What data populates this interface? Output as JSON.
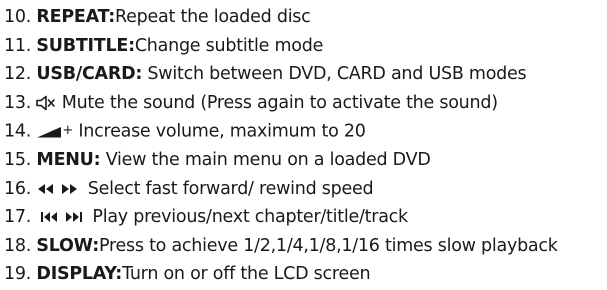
{
  "items": [
    {
      "num": "10.",
      "key": "REPEAT:",
      "text": "Repeat the loaded disc"
    },
    {
      "num": "11.",
      "key": "SUBTITLE:",
      "text": "Change subtitle mode"
    },
    {
      "num": "12.",
      "key": "USB/CARD:",
      "text": " Switch between DVD, CARD and USB modes"
    },
    {
      "num": "13.",
      "icon": "mute-icon",
      "text": " Mute the sound (Press again to activate the sound)"
    },
    {
      "num": "14.",
      "icon": "volume-up-icon",
      "plus": "+",
      "text": " Increase volume, maximum to 20"
    },
    {
      "num": "15.",
      "key": "MENU:",
      "text": " View the main menu on a loaded DVD"
    },
    {
      "num": "16.",
      "icon": "rewind-fast-forward-icon",
      "text": " Select fast forward/ rewind speed"
    },
    {
      "num": "17.",
      "icon": "previous-next-icon",
      "text": "Play previous/next chapter/title/track"
    },
    {
      "num": "18.",
      "key": "SLOW:",
      "text": "Press to achieve 1/2,1/4,1/8,1/16 times slow playback"
    },
    {
      "num": "19.",
      "key": "DISPLAY:",
      "text": "Turn on or off the LCD screen"
    }
  ]
}
